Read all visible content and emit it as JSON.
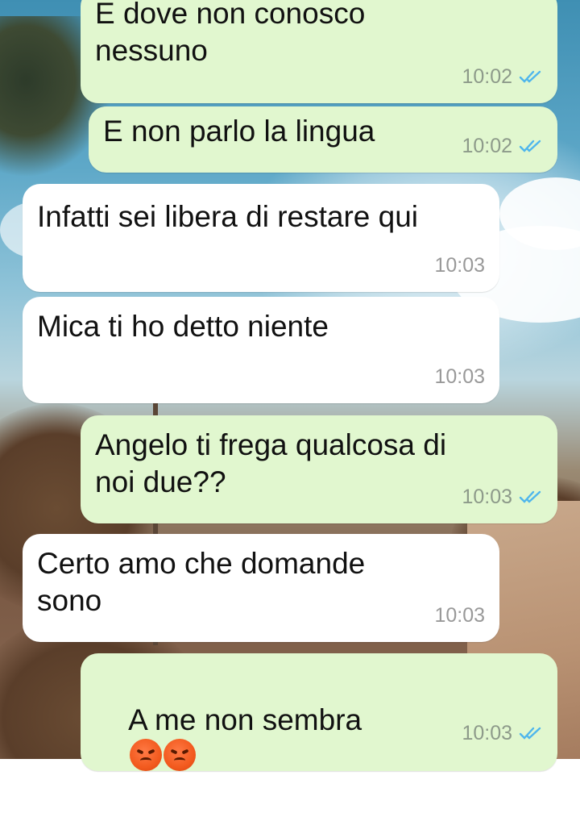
{
  "messages": [
    {
      "direction": "outgoing",
      "text": "E dove non conosco\nnessuno",
      "time": "10:02",
      "status": "read"
    },
    {
      "direction": "outgoing",
      "text": "E non parlo la lingua",
      "time": "10:02",
      "status": "read"
    },
    {
      "direction": "incoming",
      "text": "Infatti sei libera di restare qui",
      "time": "10:03"
    },
    {
      "direction": "incoming",
      "text": "Mica ti ho detto niente",
      "time": "10:03"
    },
    {
      "direction": "outgoing",
      "text": "Angelo ti frega qualcosa di\nnoi due??",
      "time": "10:03",
      "status": "read"
    },
    {
      "direction": "incoming",
      "text": "Certo amo che domande\nsono",
      "time": "10:03"
    },
    {
      "direction": "outgoing",
      "text": "A me non sembra",
      "emojis": [
        "angry-face-icon",
        "angry-face-icon"
      ],
      "time": "10:03",
      "status": "read"
    }
  ],
  "colors": {
    "outgoing_bubble": "#e1f7cf",
    "incoming_bubble": "#ffffff",
    "read_ticks": "#4fb6ec"
  }
}
